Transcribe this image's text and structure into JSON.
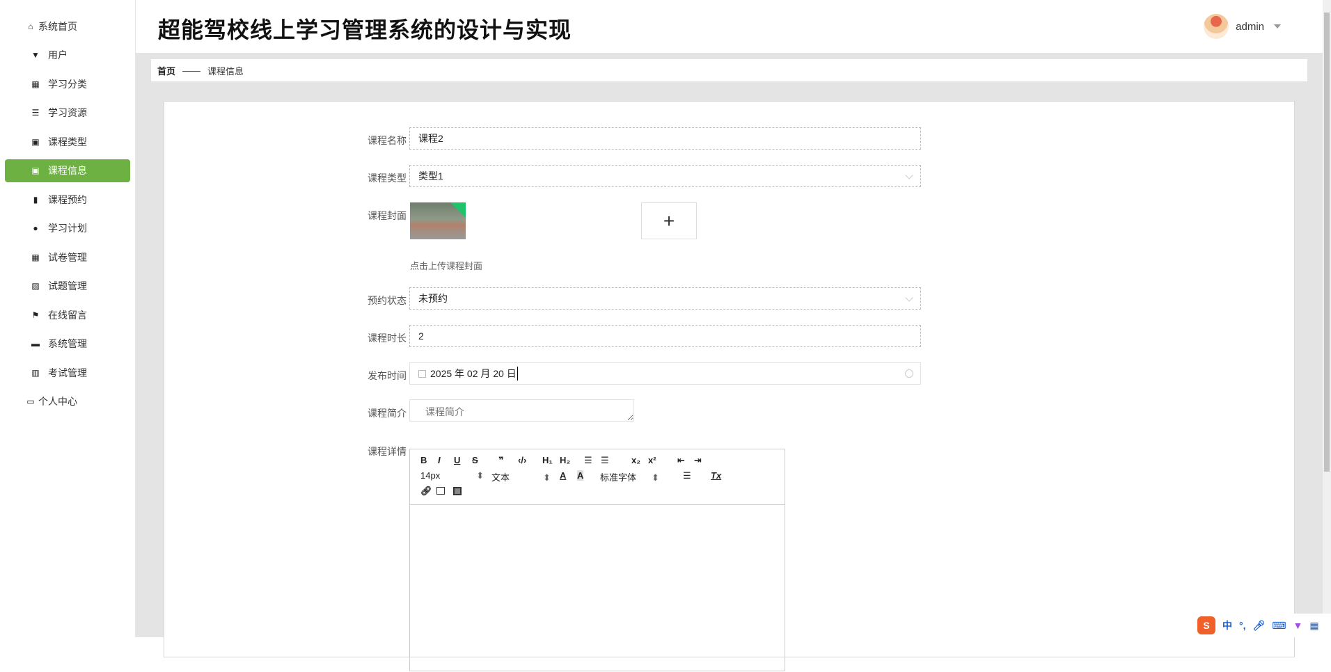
{
  "sidebar": {
    "items": [
      {
        "label": "系统首页",
        "icon": "home-icon"
      },
      {
        "label": "用户",
        "icon": "pin-icon"
      },
      {
        "label": "学习分类",
        "icon": "grid-icon"
      },
      {
        "label": "学习资源",
        "icon": "list-icon"
      },
      {
        "label": "课程类型",
        "icon": "clipboard-x-icon"
      },
      {
        "label": "课程信息",
        "icon": "clipboard-check-icon",
        "active": true
      },
      {
        "label": "课程预约",
        "icon": "book-icon"
      },
      {
        "label": "学习计划",
        "icon": "bulb-icon"
      },
      {
        "label": "试卷管理",
        "icon": "grid-icon"
      },
      {
        "label": "试题管理",
        "icon": "chart-icon"
      },
      {
        "label": "在线留言",
        "icon": "flag-icon"
      },
      {
        "label": "系统管理",
        "icon": "briefcase-icon"
      },
      {
        "label": "考试管理",
        "icon": "bar-chart-icon"
      },
      {
        "label": "个人中心",
        "icon": "card-icon"
      }
    ]
  },
  "header": {
    "title": "超能驾校线上学习管理系统的设计与实现",
    "username": "admin"
  },
  "breadcrumb": {
    "home": "首页",
    "separator": "——",
    "current": "课程信息"
  },
  "form": {
    "name": {
      "label": "课程名称",
      "value": "课程2"
    },
    "type": {
      "label": "课程类型",
      "value": "类型1"
    },
    "cover": {
      "label": "课程封面",
      "hint": "点击上传课程封面",
      "add": "+"
    },
    "status": {
      "label": "预约状态",
      "value": "未预约"
    },
    "duration": {
      "label": "课程时长",
      "value": "2"
    },
    "publish": {
      "label": "发布时间",
      "value": "2025 年 02 月 20 日"
    },
    "intro": {
      "label": "课程简介",
      "placeholder": "课程简介"
    },
    "detail": {
      "label": "课程详情"
    }
  },
  "editor": {
    "row1": [
      "B",
      "I",
      "U",
      "S",
      "❞",
      "‹/›",
      "H₁",
      "H₂",
      "☰",
      "☰",
      "x₂",
      "x²",
      "⇤",
      "⇥"
    ],
    "font_size": "14px",
    "text_type": "文本",
    "font_family": "标准字体",
    "color": "A",
    "bg": "A",
    "clear": "Tx"
  },
  "ime": {
    "lang": "中",
    "punct": "°,"
  }
}
